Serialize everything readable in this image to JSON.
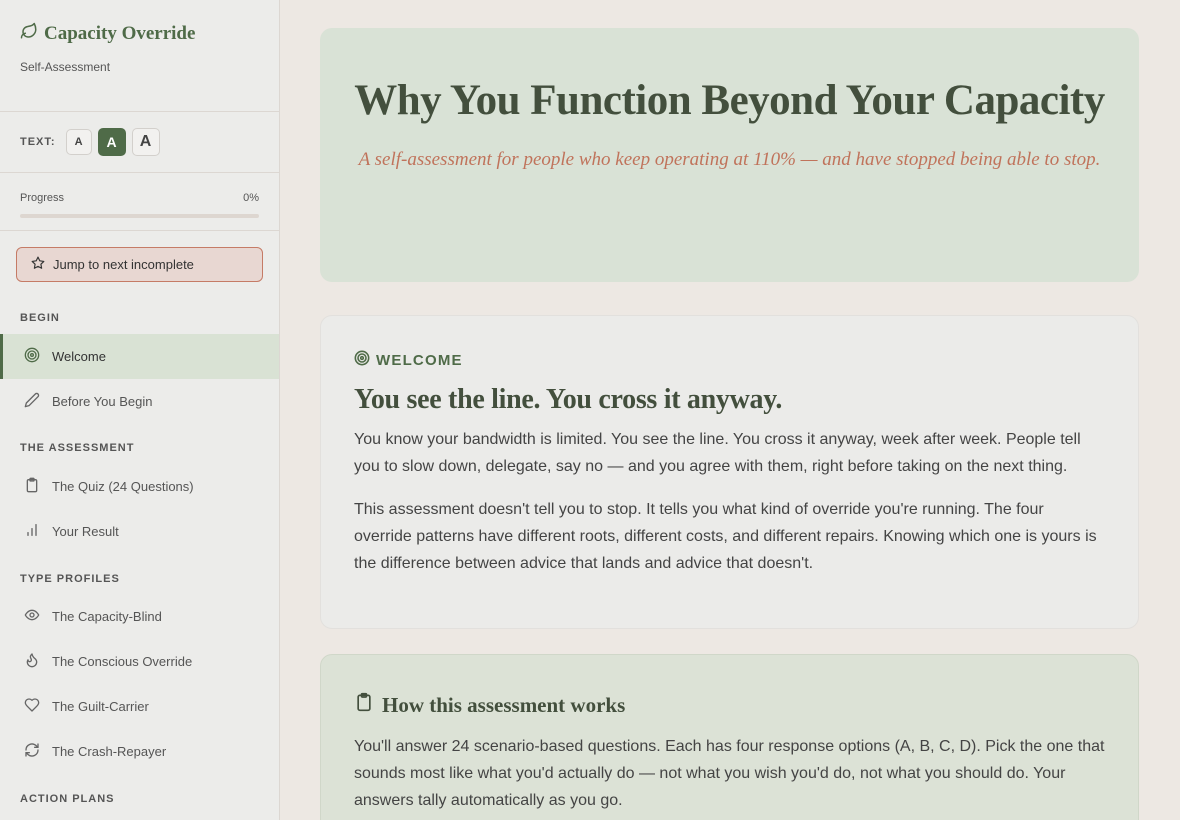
{
  "sidebar": {
    "brand_title": "Capacity Override",
    "brand_subtitle": "Self-Assessment",
    "text_size": {
      "label": "TEXT:",
      "small": "A",
      "medium": "A",
      "large": "A",
      "selected": "medium"
    },
    "progress": {
      "label": "Progress",
      "value_text": "0%",
      "percent": 0
    },
    "jump_button": "Jump to next incomplete",
    "sections": [
      {
        "title": "BEGIN",
        "items": [
          {
            "label": "Welcome",
            "icon": "target-icon",
            "active": true
          },
          {
            "label": "Before You Begin",
            "icon": "pencil-icon"
          }
        ]
      },
      {
        "title": "THE ASSESSMENT",
        "items": [
          {
            "label": "The Quiz (24 Questions)",
            "icon": "clipboard-icon"
          },
          {
            "label": "Your Result",
            "icon": "bar-chart-icon"
          }
        ]
      },
      {
        "title": "TYPE PROFILES",
        "items": [
          {
            "label": "The Capacity-Blind",
            "icon": "eye-icon"
          },
          {
            "label": "The Conscious Override",
            "icon": "flame-icon"
          },
          {
            "label": "The Guilt-Carrier",
            "icon": "heart-icon"
          },
          {
            "label": "The Crash-Repayer",
            "icon": "refresh-icon"
          }
        ]
      },
      {
        "title": "ACTION PLANS",
        "items": []
      }
    ]
  },
  "hero": {
    "title": "Why You Function Beyond Your Capacity",
    "subtitle": "A self-assessment for people who keep operating at 110% — and have stopped being able to stop."
  },
  "welcome": {
    "eyebrow": "WELCOME",
    "heading": "You see the line. You cross it anyway.",
    "paragraphs": [
      "You know your bandwidth is limited. You see the line. You cross it anyway, week after week. People tell you to slow down, delegate, say no — and you agree with them, right before taking on the next thing.",
      "This assessment doesn't tell you to stop. It tells you what kind of override you're running. The four override patterns have different roots, different costs, and different repairs. Knowing which one is yours is the difference between advice that lands and advice that doesn't."
    ]
  },
  "how": {
    "title": "How this assessment works",
    "paragraph": "You'll answer 24 scenario-based questions. Each has four response options (A, B, C, D). Pick the one that sounds most like what you'd actually do — not what you wish you'd do, not what you should do. Your answers tally automatically as you go."
  },
  "colors": {
    "accent": "#4f6b48",
    "hero_bg": "#d9e2d6",
    "subtitle": "#c0735b",
    "jump_border": "#c57b66"
  }
}
